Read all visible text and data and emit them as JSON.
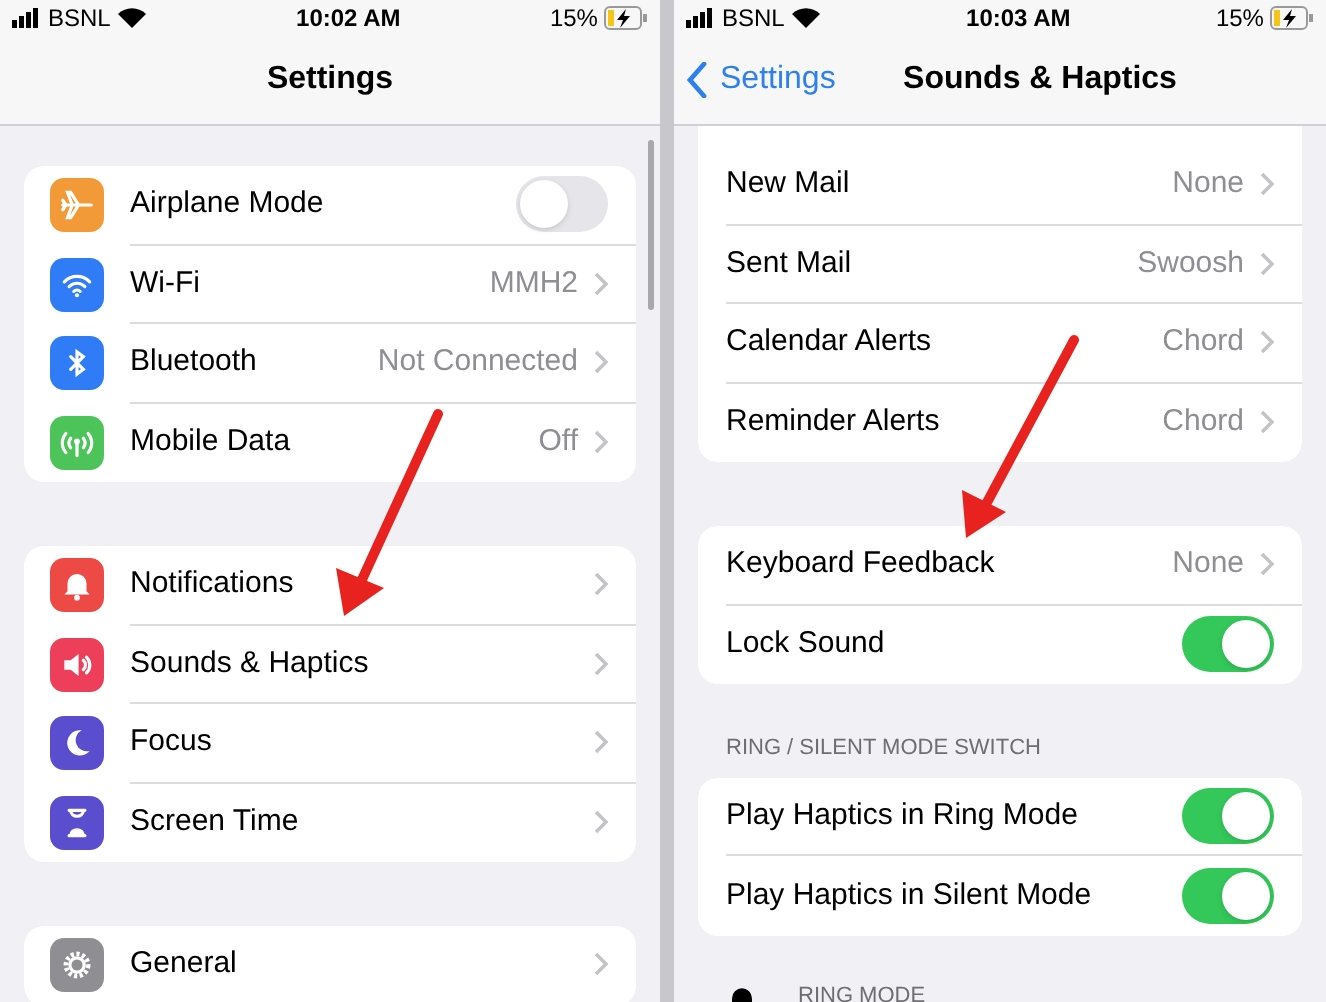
{
  "left": {
    "status": {
      "carrier": "BSNL",
      "time": "10:02 AM",
      "battery": "15%"
    },
    "title": "Settings",
    "groups": [
      {
        "rows": [
          {
            "kind": "toggle",
            "label": "Airplane Mode",
            "on": false,
            "color": "#f29a38"
          },
          {
            "kind": "link",
            "label": "Wi-Fi",
            "value": "MMH2",
            "color": "#2f7cf6"
          },
          {
            "kind": "link",
            "label": "Bluetooth",
            "value": "Not Connected",
            "color": "#2f7cf6"
          },
          {
            "kind": "link",
            "label": "Mobile Data",
            "value": "Off",
            "color": "#4cc45a"
          }
        ]
      },
      {
        "rows": [
          {
            "kind": "link",
            "label": "Notifications",
            "color": "#ee4a45"
          },
          {
            "kind": "link",
            "label": "Sounds & Haptics",
            "color": "#ee3f5a"
          },
          {
            "kind": "link",
            "label": "Focus",
            "color": "#5a4ecf"
          },
          {
            "kind": "link",
            "label": "Screen Time",
            "color": "#5a4ecf"
          }
        ]
      },
      {
        "rows": [
          {
            "kind": "link",
            "label": "General",
            "color": "#8e8e93"
          }
        ]
      }
    ]
  },
  "right": {
    "status": {
      "carrier": "BSNL",
      "time": "10:03 AM",
      "battery": "15%"
    },
    "back": "Settings",
    "title": "Sounds & Haptics",
    "groups": [
      {
        "cut": true,
        "rows": [
          {
            "kind": "link",
            "label": "New Mail",
            "value": "None"
          },
          {
            "kind": "link",
            "label": "Sent Mail",
            "value": "Swoosh"
          },
          {
            "kind": "link",
            "label": "Calendar Alerts",
            "value": "Chord"
          },
          {
            "kind": "link",
            "label": "Reminder Alerts",
            "value": "Chord"
          }
        ]
      },
      {
        "rows": [
          {
            "kind": "link",
            "label": "Keyboard Feedback",
            "value": "None"
          },
          {
            "kind": "toggle",
            "label": "Lock Sound",
            "on": true
          }
        ]
      },
      {
        "header": "RING / SILENT MODE SWITCH",
        "rows": [
          {
            "kind": "toggle",
            "label": "Play Haptics in Ring Mode",
            "on": true
          },
          {
            "kind": "toggle",
            "label": "Play Haptics in Silent Mode",
            "on": true
          }
        ]
      }
    ],
    "footer": "RING MODE"
  }
}
